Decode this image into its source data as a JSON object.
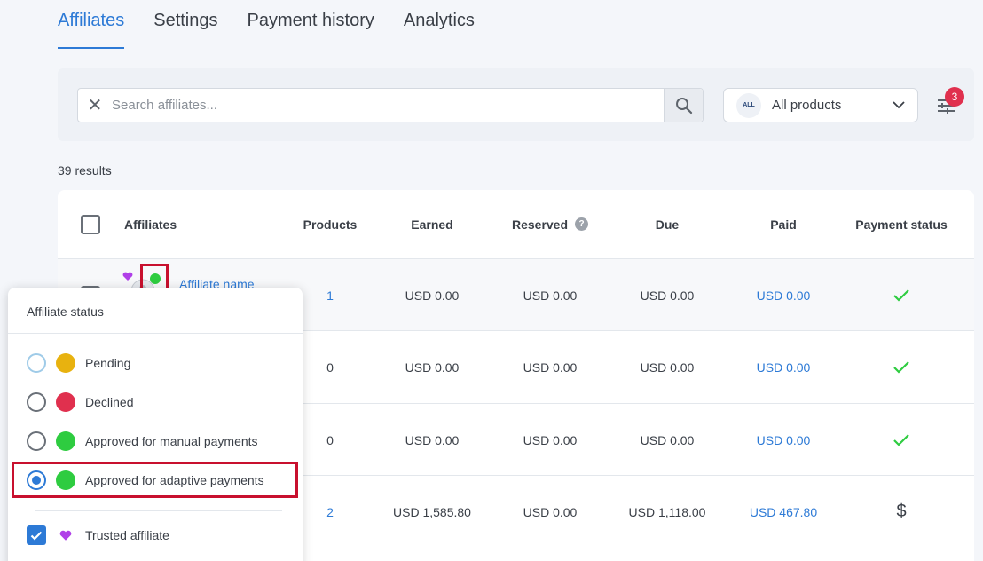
{
  "tabs": [
    "Affiliates",
    "Settings",
    "Payment history",
    "Analytics"
  ],
  "search": {
    "placeholder": "Search affiliates..."
  },
  "products_filter": {
    "badge": "ALL",
    "label": "All products"
  },
  "filter_count": "3",
  "results": "39 results",
  "columns": [
    "Affiliates",
    "Products",
    "Earned",
    "Reserved",
    "Due",
    "Paid",
    "Payment status"
  ],
  "reserved_help": "?",
  "rows": [
    {
      "name": "Affiliate name",
      "products": "1",
      "earned": "USD 0.00",
      "reserved": "USD 0.00",
      "due": "USD 0.00",
      "paid": "USD 0.00",
      "status_icon": "check-icon"
    },
    {
      "products": "0",
      "earned": "USD 0.00",
      "reserved": "USD 0.00",
      "due": "USD 0.00",
      "paid": "USD 0.00",
      "status_icon": "check-icon"
    },
    {
      "products": "0",
      "earned": "USD 0.00",
      "reserved": "USD 0.00",
      "due": "USD 0.00",
      "paid": "USD 0.00",
      "status_icon": "check-icon"
    },
    {
      "products": "2",
      "earned": "USD 1,585.80",
      "reserved": "USD 0.00",
      "due": "USD 1,118.00",
      "paid": "USD 467.80",
      "status_icon": "dollar-icon",
      "status_text": "$"
    }
  ],
  "popup": {
    "title": "Affiliate status",
    "options": [
      "Pending",
      "Declined",
      "Approved for manual payments",
      "Approved for adaptive payments"
    ],
    "selected": "Approved for adaptive payments",
    "trusted": "Trusted affiliate",
    "trusted_checked": true
  },
  "colors": {
    "accent": "#2d7ad6",
    "pending": "#e8b20f",
    "declined": "#e0304e",
    "approved": "#2ecc40",
    "trusted": "#b040e8",
    "highlight": "#c8102e"
  }
}
